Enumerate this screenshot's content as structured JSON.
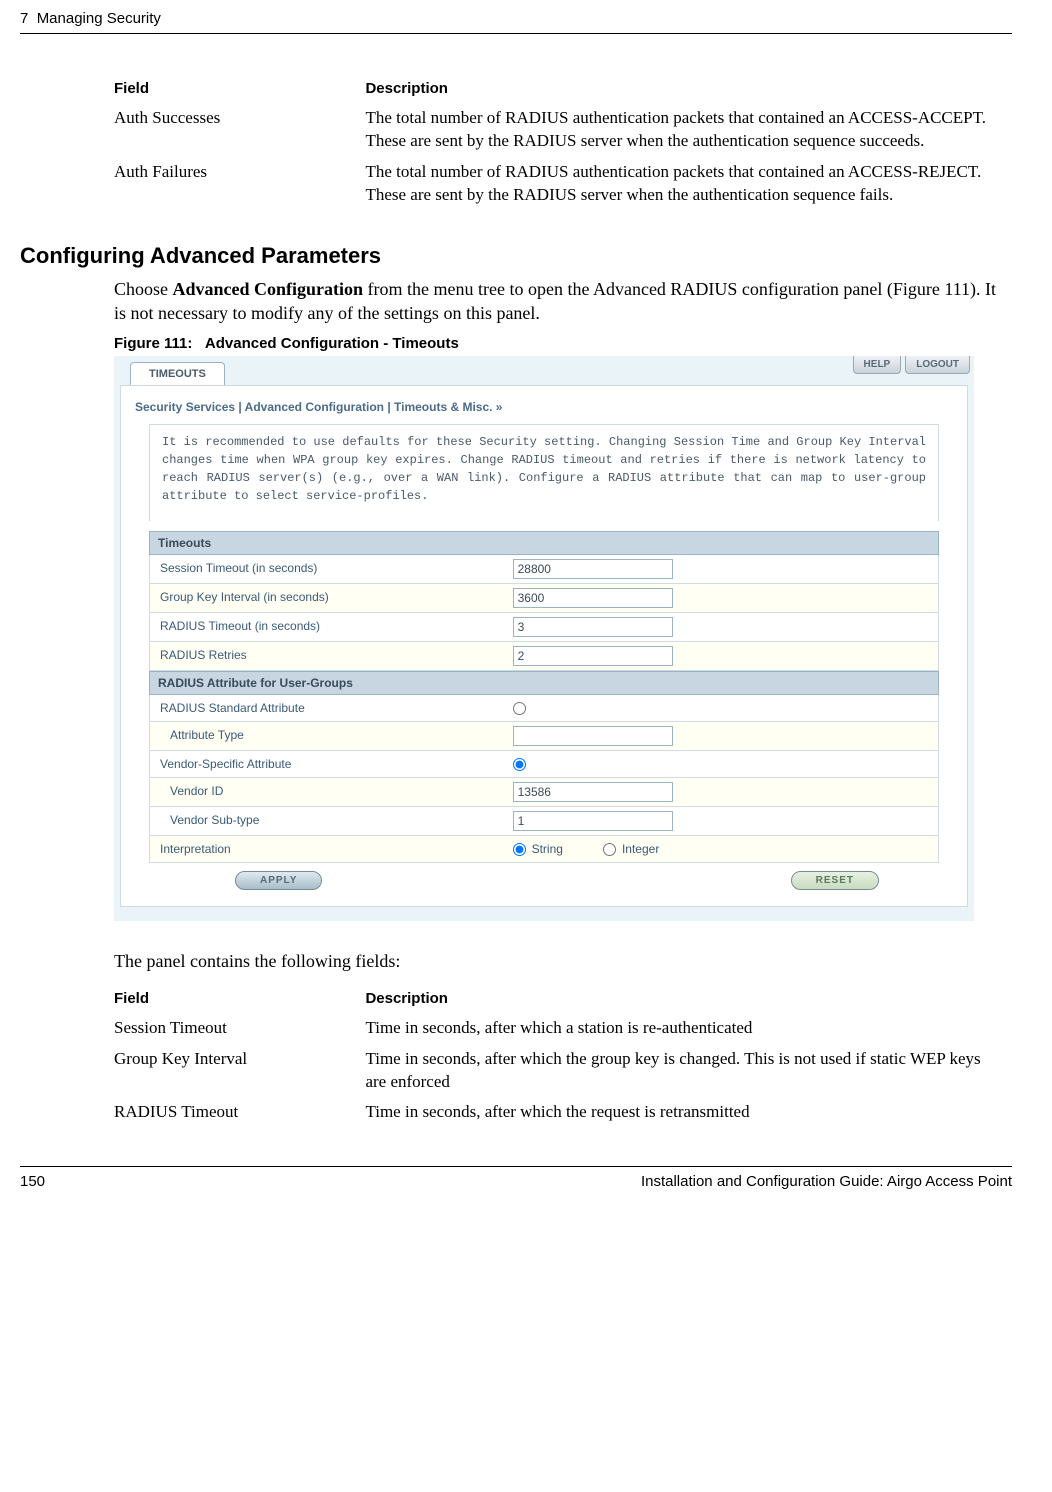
{
  "page_header": {
    "chapter": "7",
    "title": "Managing Security"
  },
  "table1": {
    "head_field": "Field",
    "head_desc": "Description",
    "rows": [
      {
        "field": "Auth Successes",
        "desc": "The total number of RADIUS authentication packets that contained an ACCESS-ACCEPT. These are sent by the RADIUS server when the authentication sequence succeeds."
      },
      {
        "field": "Auth Failures",
        "desc": "The total number of RADIUS authentication packets that contained an ACCESS-REJECT. These are sent by the RADIUS server when the authentication sequence fails."
      }
    ]
  },
  "section_heading": "Configuring Advanced Parameters",
  "intro_para_1": "Choose ",
  "intro_bold": "Advanced Configuration",
  "intro_para_2": " from the menu tree to open the Advanced RADIUS configuration panel (Figure 111). It is not necessary to modify any of the settings on this panel.",
  "figure_caption_prefix": "Figure 111:",
  "figure_caption": "Advanced Configuration - Timeouts",
  "screenshot": {
    "tab": "TIMEOUTS",
    "help": "HELP",
    "logout": "LOGOUT",
    "breadcrumb": "Security Services | Advanced Configuration | Timeouts & Misc.  »",
    "note": "It is recommended to use defaults for these Security setting. Changing Session Time and Group Key Interval changes time when WPA group key expires. Change RADIUS timeout and retries if there is network latency to reach RADIUS server(s) (e.g., over a WAN link). Configure a RADIUS attribute that can map to user-group attribute to select service-profiles.",
    "sec_timeouts": "Timeouts",
    "lbl_session": "Session Timeout (in seconds)",
    "val_session": "28800",
    "lbl_groupkey": "Group Key Interval (in seconds)",
    "val_groupkey": "3600",
    "lbl_radius_to": "RADIUS Timeout (in seconds)",
    "val_radius_to": "3",
    "lbl_radius_retries": "RADIUS Retries",
    "val_radius_retries": "2",
    "sec_attr": "RADIUS Attribute for User-Groups",
    "lbl_std_attr": "RADIUS Standard Attribute",
    "lbl_attr_type": "Attribute Type",
    "val_attr_type": "",
    "lbl_vendor_spec": "Vendor-Specific Attribute",
    "lbl_vendor_id": "Vendor ID",
    "val_vendor_id": "13586",
    "lbl_vendor_sub": "Vendor Sub-type",
    "val_vendor_sub": "1",
    "lbl_interpretation": "Interpretation",
    "radio_string": "String",
    "radio_integer": "Integer",
    "btn_apply": "APPLY",
    "btn_reset": "RESET"
  },
  "panel_intro": "The panel contains the following fields:",
  "table2": {
    "head_field": "Field",
    "head_desc": "Description",
    "rows": [
      {
        "field": "Session Timeout",
        "desc": "Time in seconds, after which a station is re-authenticated"
      },
      {
        "field": "Group Key Interval",
        "desc": "Time in seconds, after which the group key is changed. This is not used if static WEP keys are enforced"
      },
      {
        "field": "RADIUS Timeout",
        "desc": "Time in seconds, after which the request is retransmitted"
      }
    ]
  },
  "footer": {
    "page": "150",
    "doc": "Installation and Configuration Guide: Airgo Access Point"
  }
}
